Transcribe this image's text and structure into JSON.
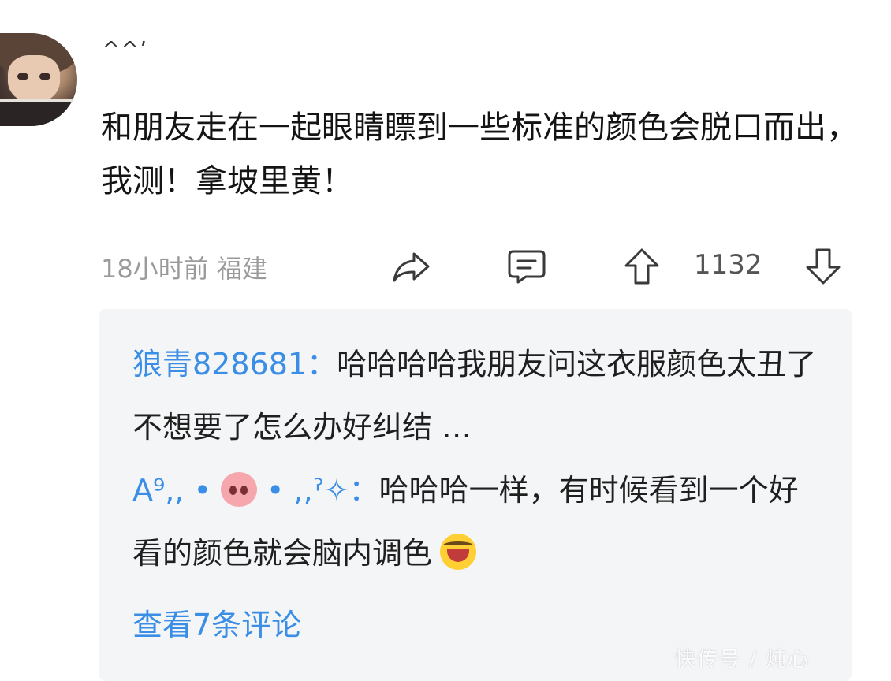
{
  "post": {
    "username": "^^’",
    "content": "和朋友走在一起眼睛瞟到一些标准的颜色会脱口而出，我测！拿坡里黄！",
    "meta": "18小时前 福建",
    "vote_count": "1132"
  },
  "icons": {
    "share": "share-icon",
    "comment": "comment-icon",
    "upvote": "arrow-up-icon",
    "downvote": "arrow-down-icon"
  },
  "replies": [
    {
      "author": "狼青828681",
      "separator": "：",
      "text": "哈哈哈哈我朋友问这衣服颜色太丑了不想要了怎么办好纠结 …"
    },
    {
      "author_prefix": "A⁹,, • ",
      "author_suffix": " • ,,ˀ✧",
      "separator": "：",
      "text": "哈哈哈一样，有时候看到一个好看的颜色就会脑内调色"
    }
  ],
  "view_more": "查看7条评论",
  "watermark": "快传号 / 炖心",
  "colors": {
    "link": "#3a8ee6",
    "reply_bg": "#f4f5f7",
    "meta": "#9a9a9a"
  }
}
